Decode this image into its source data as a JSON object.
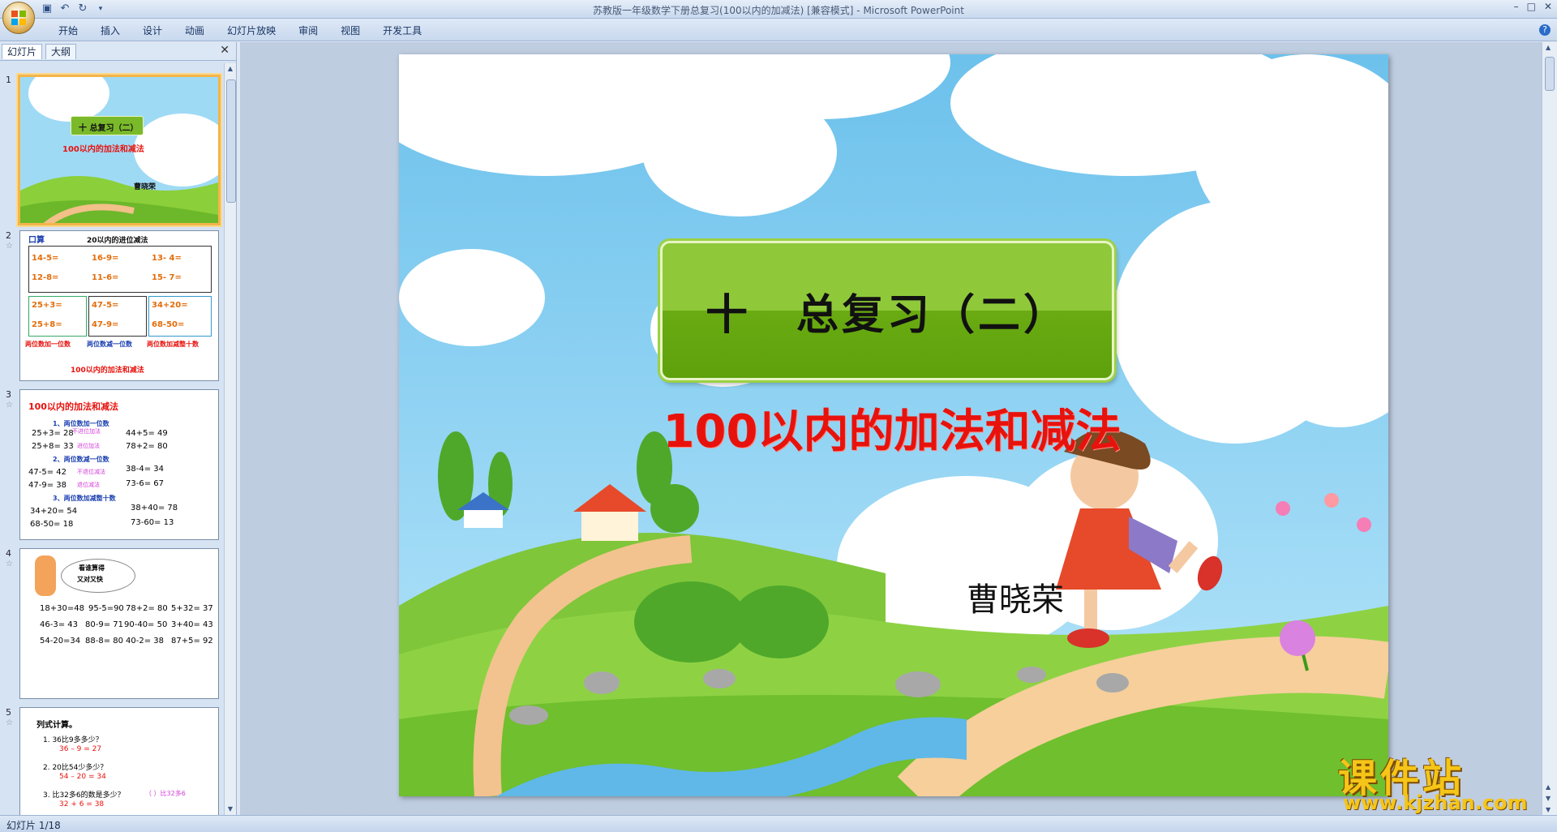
{
  "window": {
    "title": "苏教版一年级数学下册总复习(100以内的加减法) [兼容模式] - Microsoft PowerPoint",
    "controls": [
      "–",
      "□",
      "✕"
    ]
  },
  "quick_access": {
    "save_icon": "save-icon",
    "undo_icon": "undo-icon",
    "redo_icon": "redo-icon"
  },
  "ribbon": {
    "tabs": [
      "开始",
      "插入",
      "设计",
      "动画",
      "幻灯片放映",
      "审阅",
      "视图",
      "开发工具"
    ],
    "help": "?"
  },
  "panel": {
    "tabs": [
      "幻灯片",
      "大纲"
    ],
    "close": "✕",
    "thumbs": [
      {
        "num": "1",
        "title": "十 总复习（二）",
        "subtitle": "100以内的加法和减法",
        "author": "曹晓荣"
      },
      {
        "num": "2",
        "star": "☆",
        "heading": "口算",
        "subheading": "20以内的进位减法",
        "rows": [
          [
            "14-5=",
            "16-9=",
            "13- 4="
          ],
          [
            "12-8=",
            "11-6=",
            "15- 7="
          ],
          [
            "25+3=",
            "47-5=",
            "34+20="
          ],
          [
            "25+8=",
            "47-9=",
            "68-50="
          ]
        ],
        "labels": [
          "两位数加一位数",
          "两位数减一位数",
          "两位数加减整十数"
        ],
        "footer": "100以内的加法和减法"
      },
      {
        "num": "3",
        "star": "☆",
        "heading": "100以内的加法和减法",
        "lines": [
          "1、两位数加一位数",
          "25+3= 28",
          "44+5= 49",
          "25+8= 33",
          "78+2= 80",
          "2、两位数减一位数",
          "47-5= 42",
          "38-4= 34",
          "47-9= 38",
          "73-6= 67",
          "3、两位数加减整十数",
          "34+20= 54",
          "38+40= 78",
          "68-50= 18",
          "73-60= 13"
        ],
        "notes": [
          "不进位加法",
          "进位加法",
          "不退位减法",
          "退位减法"
        ]
      },
      {
        "num": "4",
        "star": "☆",
        "bubble": [
          "看谁算得",
          "又对又快"
        ],
        "rows": [
          [
            "18+30=48",
            "95-5=90",
            "78+2= 80",
            "5+32= 37"
          ],
          [
            "46-3= 43",
            "80-9= 71",
            "90-40= 50",
            "3+40= 43"
          ],
          [
            "54-20=34",
            "88-8= 80",
            "40-2= 38",
            "87+5= 92"
          ]
        ]
      },
      {
        "num": "5",
        "star": "☆",
        "heading": "列式计算。",
        "items": [
          "1.  36比9多多少？",
          "36 – 9 = 27",
          "2.  20比54少多少？",
          "54 – 20 = 34",
          "3.  比32多6的数是多少？",
          "32 + 6 = 38"
        ],
        "note": "（  ）比32多6"
      }
    ]
  },
  "slide": {
    "title": "十　总复习（二）",
    "subtitle": "100以内的加法和减法",
    "author": "曹晓荣"
  },
  "watermark": {
    "line1": "课件站",
    "line2": "www.kjzhan.com"
  },
  "status": {
    "text": "幻灯片 1/18"
  },
  "colors": {
    "title_green": "#8fc93a",
    "subtitle_red": "#e8120d",
    "sky": "#8ed0f0",
    "accent_orange": "#f3b54a"
  }
}
